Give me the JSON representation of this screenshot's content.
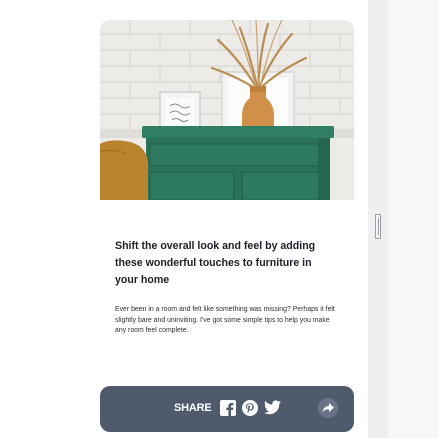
{
  "article": {
    "image_alt": "Green dresser with vase of dried pampas grass and framed print against white brick wall",
    "headline": "Shift the overall look and feel by adding these wonderful touches to furniture in your home",
    "body": "Ever been in a room and felt like something was missing? Perhaps it felt slightly bare and uninviting. I've got some simple tips to help you make any room feel complete."
  },
  "share": {
    "label": "SHARE",
    "icons": [
      "facebook-icon",
      "pinterest-icon",
      "twitter-icon",
      "forward-icon"
    ]
  },
  "colors": {
    "share_bar": "#4f5a6d",
    "dresser": "#2d7a5f",
    "text_dark": "#1e1e28"
  }
}
